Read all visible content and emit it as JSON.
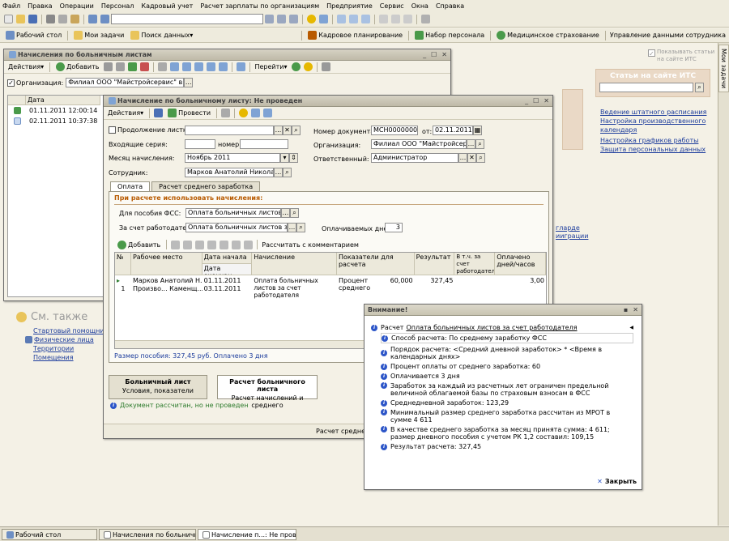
{
  "menu": [
    "Файл",
    "Правка",
    "Операции",
    "Персонал",
    "Кадровый учет",
    "Расчет зарплаты по организациям",
    "Предприятие",
    "Сервис",
    "Окна",
    "Справка"
  ],
  "toolbar2": [
    "Рабочий стол",
    "Мои задачи",
    "Поиск данных"
  ],
  "toolbar2_right": [
    "Кадровое планирование",
    "Набор персонала",
    "Медицинское страхование",
    "Управление данными сотрудника"
  ],
  "right_panel": {
    "tab": "Мои задачи",
    "checkbox_label": "Показывать статьи на сайте ИТС",
    "its_title": "Статьи на сайте ИТС",
    "links": [
      "Ведение штатного расписания",
      "Настройка производственного календаря",
      "Настройка графиков работы",
      "Защита персональных данных"
    ],
    "partial_links": [
      "гларде",
      "ииграции"
    ]
  },
  "see_also": {
    "title": "См. также",
    "links": [
      "Стартовый помощник",
      "Физические лица",
      "Территории",
      "Помещения"
    ]
  },
  "win_list": {
    "title": "Начисления по больничным листам",
    "toolbar": {
      "actions": "Действия",
      "add": "Добавить",
      "go": "Перейти"
    },
    "org_label": "Организация:",
    "org_value": "Филиал ООО \"Майстройсервис\" в г. Н",
    "col_date": "Дата",
    "rows": [
      {
        "date": "01.11.2011 12:00:14"
      },
      {
        "date": "02.11.2011 10:37:38"
      }
    ]
  },
  "win_doc": {
    "title": "Начисление по больничному листу: Не проведен",
    "toolbar": {
      "actions": "Действия",
      "post": "Провести"
    },
    "cont_label": "Продолжение листка",
    "series_label": "Входящие серия:",
    "number_label": "номер:",
    "month_label": "Месяц начисления:",
    "month_value": "Ноябрь 2011",
    "emp_label": "Сотрудник:",
    "emp_value": "Марков Анатолий Николаеви",
    "docnum_label": "Номер документа:",
    "docnum_value": "МСН00000002",
    "from_label": "от:",
    "date_value": "02.11.2011",
    "org_label": "Организация:",
    "org_value": "Филиал ООО \"Майстройсервис",
    "resp_label": "Ответственный:",
    "resp_value": "Администратор",
    "tabs": [
      "Оплата",
      "Расчет среднего заработка"
    ],
    "section_title": "При расчете использовать начисления:",
    "fss_label": "Для пособия ФСС:",
    "fss_value": "Оплата больничных листов",
    "employer_label": "За счет работодателя:",
    "employer_value": "Оплата больничных листов за сче",
    "days_label": "Оплачиваемых дней:",
    "days_value": "3",
    "grid_add": "Добавить",
    "grid_calc": "Рассчитать с комментарием",
    "columns": {
      "n": "№",
      "workplace": "Рабочее место",
      "date_start": "Дата начала",
      "date_end": "Дата окончан...",
      "accrual": "Начисление",
      "indicators": "Показатели для расчета",
      "result": "Результат",
      "employer": "В т.ч. за счет работодателя",
      "paid": "Оплачено дней/часов"
    },
    "row": {
      "n": "1",
      "workplace1": "Марков Анатолий Н...",
      "workplace2": "Произво... Каменщ...",
      "date_start": "01.11.2011",
      "date_end": "03.11.2011",
      "accrual": "Оплата больничных листов за счет работодателя",
      "ind_name": "Процент среднего",
      "ind_value": "60,000",
      "result": "327,45",
      "paid": "3,00"
    },
    "summary": "Размер пособия: 327,45 руб. Оплачено 3 дня",
    "btn_sick_title": "Больничный лист",
    "btn_sick_sub": "Условия, показатели",
    "btn_calc_title": "Расчет больничного листа",
    "btn_calc_sub": "Расчет начислений и среднего",
    "status": "Документ рассчитан, но не проведен",
    "footer": "Расчет среднего"
  },
  "win_attention": {
    "title": "Внимание!",
    "head_prefix": "Расчет",
    "head_link": "Оплата больничных листов за счет работодателя",
    "items": [
      "Способ расчета: По среднему заработку ФСС",
      "Порядок расчета: <Средний дневной заработок> * <Время в календарных днях>",
      "Процент оплаты от среднего заработка: 60",
      "Оплачивается 3 дня",
      "Заработок за каждый из расчетных лет ограничен предельной величиной облагаемой базы по страховым взносам в ФСС",
      "Среднедневной заработок: 123,29",
      "Минимальный размер среднего заработка рассчитан из МРОТ в сумме 4 611",
      "В качестве среднего заработка за месяц принята сумма: 4 611; размер дневного пособия с учетом РК 1,2 составил: 109,15",
      "Результат расчета: 327,45"
    ],
    "close": "Закрыть"
  },
  "taskbar": [
    "Рабочий стол",
    "Начисления по больничны...",
    "Начисление п...: Не проведен"
  ],
  "colors": {
    "link": "#1c3c9c",
    "accent_orange": "#b85a00",
    "status_green": "#2b7a2b",
    "info_blue": "#2c55c8"
  }
}
